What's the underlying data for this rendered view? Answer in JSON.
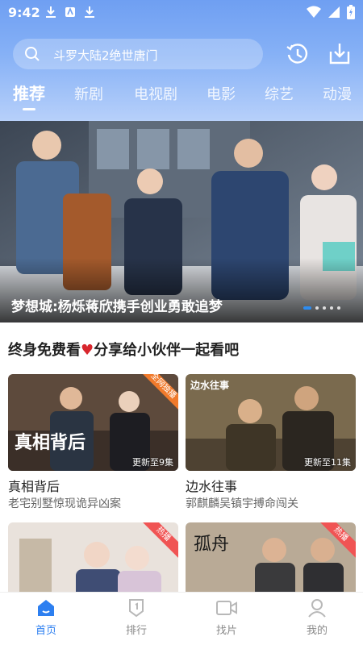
{
  "status_bar": {
    "time": "9:42",
    "left_icons": [
      "download-icon",
      "app-icon",
      "download-icon"
    ],
    "right_icons": [
      "wifi-icon",
      "signal-icon",
      "battery-icon"
    ]
  },
  "search": {
    "placeholder": "斗罗大陆2绝世唐门",
    "history_icon": "history-icon",
    "download_icon": "download-icon"
  },
  "tabs": [
    {
      "label": "推荐",
      "active": true
    },
    {
      "label": "新剧",
      "active": false
    },
    {
      "label": "电视剧",
      "active": false
    },
    {
      "label": "电影",
      "active": false
    },
    {
      "label": "综艺",
      "active": false
    },
    {
      "label": "动漫",
      "active": false
    }
  ],
  "banner": {
    "title": "梦想城:杨烁蒋欣携手创业勇敢追梦",
    "page_count": 5,
    "current_page": 1
  },
  "section": {
    "title_part1": "终身免费看",
    "title_part2": "分享给小伙伴一起看吧"
  },
  "cards": [
    {
      "title": "真相背后",
      "subtitle": "老宅别墅惊现诡异凶案",
      "badge": "更新至9集",
      "thumb_text": "真相背后",
      "corner": "全网独播"
    },
    {
      "title": "边水往事",
      "subtitle": "郭麒麟吴镇宇搏命闯关",
      "badge": "更新至11集",
      "thumb_text": "边水往事"
    },
    {
      "title": "",
      "subtitle": "",
      "badge": "",
      "corner": "热播"
    },
    {
      "title": "",
      "subtitle": "",
      "badge": "",
      "thumb_text": "孤舟",
      "corner": "热播"
    }
  ],
  "bottom_nav": [
    {
      "label": "首页",
      "icon": "home-icon",
      "active": true
    },
    {
      "label": "排行",
      "icon": "ranking-icon",
      "active": false
    },
    {
      "label": "找片",
      "icon": "video-icon",
      "active": false
    },
    {
      "label": "我的",
      "icon": "profile-icon",
      "active": false
    }
  ],
  "colors": {
    "accent": "#2d7ff0",
    "header_top": "#6f9ff2",
    "header_bottom": "#b7d0fa",
    "heart": "#d8262d",
    "hot_tag": "#f05454"
  }
}
